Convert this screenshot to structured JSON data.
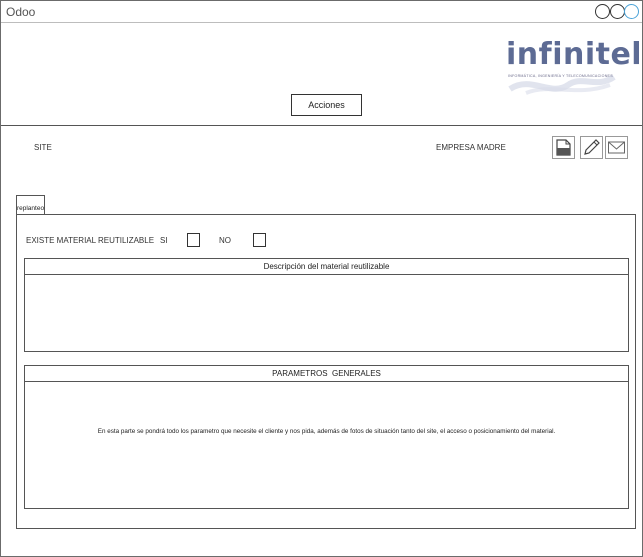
{
  "window": {
    "title": "Odoo"
  },
  "logo": {
    "name": "infinitel",
    "tagline": "INFORMÁTICA, INGENIERÍA Y TELECOMUNICACIONES",
    "brand_color": "#5d6b94"
  },
  "header": {
    "actions_label": "Acciones"
  },
  "fields": {
    "site_label": "SITE",
    "parent_company_label": "EMPRESA MADRE"
  },
  "toolbar": {
    "icons": [
      "document-icon",
      "edit-pencil-icon",
      "mail-envelope-icon"
    ]
  },
  "tabs": [
    {
      "label": "replanteo"
    }
  ],
  "form": {
    "reusable_material_label": "EXISTE MATERIAL REUTILIZABLE",
    "yes_label": "SI",
    "no_label": "NO",
    "yes_checked": false,
    "no_checked": false,
    "description_title": "Descripción del material reutilizable",
    "general_params_title": "PARAMETROS  GENERALES",
    "general_params_text": "En esta parte se pondrá todo los parametro que necesite el cliente y nos pida, además de fotos de situación tanto del site, el acceso o posicionamiento del material."
  },
  "colors": {
    "border": "#555555",
    "window_control_accent": "#4aa3d8"
  }
}
